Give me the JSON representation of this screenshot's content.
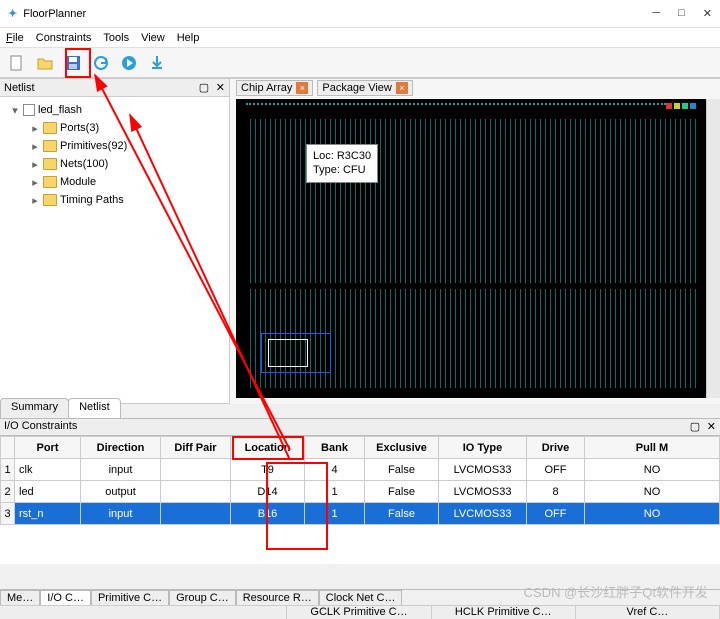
{
  "window": {
    "title": "FloorPlanner"
  },
  "menu": {
    "file": "File",
    "constraints": "Constraints",
    "tools": "Tools",
    "view": "View",
    "help": "Help"
  },
  "netlist_panel": {
    "title": "Netlist",
    "root": "led_flash",
    "items": [
      {
        "label": "Ports(3)"
      },
      {
        "label": "Primitives(92)"
      },
      {
        "label": "Nets(100)"
      },
      {
        "label": "Module"
      },
      {
        "label": "Timing Paths"
      }
    ],
    "tabs": {
      "summary": "Summary",
      "netlist": "Netlist"
    }
  },
  "chip_tabs": {
    "chip": "Chip Array",
    "pkg": "Package View"
  },
  "tooltip": {
    "line1": "Loc: R3C30",
    "line2": "Type: CFU"
  },
  "io": {
    "title": "I/O Constraints",
    "headers": [
      "Port",
      "Direction",
      "Diff Pair",
      "Location",
      "Bank",
      "Exclusive",
      "IO Type",
      "Drive",
      "Pull M"
    ],
    "rows": [
      {
        "n": "1",
        "port": "clk",
        "dir": "input",
        "diff": "",
        "loc": "T9",
        "bank": "4",
        "excl": "False",
        "iot": "LVCMOS33",
        "drive": "OFF",
        "pull": "NO"
      },
      {
        "n": "2",
        "port": "led",
        "dir": "output",
        "diff": "",
        "loc": "D14",
        "bank": "1",
        "excl": "False",
        "iot": "LVCMOS33",
        "drive": "8",
        "pull": "NO"
      },
      {
        "n": "3",
        "port": "rst_n",
        "dir": "input",
        "diff": "",
        "loc": "B16",
        "bank": "1",
        "excl": "False",
        "iot": "LVCMOS33",
        "drive": "OFF",
        "pull": "NO"
      }
    ]
  },
  "bottom_tabs": {
    "msg": "Me…",
    "io": "I/O C…",
    "prim": "Primitive C…",
    "grp": "Group C…",
    "res": "Resource R…",
    "clk": "Clock Net C…"
  },
  "status": [
    "GCLK Primitive C…",
    "HCLK Primitive C…",
    "Vref C…"
  ],
  "watermark": "CSDN @长沙红胖子Qt软件开发"
}
